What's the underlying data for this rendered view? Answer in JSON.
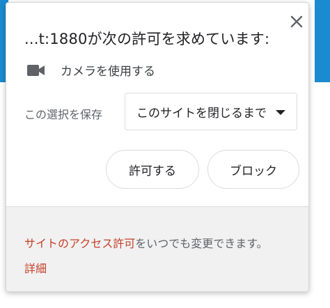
{
  "dialog": {
    "title": "...t:1880が次の許可を求めています:",
    "close_icon": "close-icon",
    "permission": {
      "icon": "camera-icon",
      "label": "カメラを使用する"
    },
    "remember": {
      "label": "この選択を保存",
      "selected": "このサイトを閉じるまで"
    },
    "buttons": {
      "allow": "許可する",
      "block": "ブロック"
    },
    "footer": {
      "link": "サイトのアクセス許可",
      "text": "をいつでも変更できます。",
      "details": "詳細"
    }
  },
  "colors": {
    "page_bar": "#1a8bd0",
    "link": "#c5402a",
    "footer_bg": "#f1f1f1"
  }
}
